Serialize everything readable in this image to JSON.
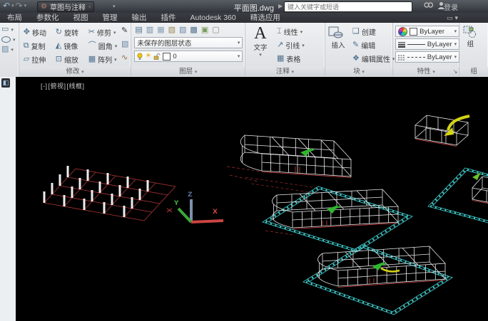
{
  "titlebar": {
    "workspace": "草图与注释",
    "doc_title": "平面图.dwg",
    "search_placeholder": "键入关键字或短语",
    "signin": "登录"
  },
  "tabs": {
    "layout": "布局",
    "parametric": "参数化",
    "view": "视图",
    "manage": "管理",
    "output": "输出",
    "plugins": "插件",
    "a360": "Autodesk 360",
    "featured": "精选应用"
  },
  "ribbon": {
    "modify": {
      "label": "修改",
      "move": "移动",
      "rotate": "旋转",
      "trim": "修剪",
      "copy": "复制",
      "mirror": "镜像",
      "fillet": "圆角",
      "stretch": "拉伸",
      "scale": "缩放",
      "array": "阵列"
    },
    "layers": {
      "label": "图层",
      "state": "未保存的图层状态",
      "current": "0"
    },
    "annotation": {
      "label": "注释",
      "text": "文字",
      "linear": "线性",
      "leader": "引线",
      "table": "表格"
    },
    "block": {
      "label": "块",
      "insert": "插入",
      "create": "创建",
      "edit": "编辑",
      "edit_attr": "编辑属性"
    },
    "properties": {
      "label": "特性",
      "color": "ByLayer",
      "lineweight": "ByLayer",
      "linetype": "ByLayer"
    },
    "group": {
      "label": "组",
      "tool": "组"
    }
  },
  "viewport": {
    "menu": "[-]",
    "view": "[俯视]",
    "style": "[线框]"
  },
  "colors": {
    "canvas": "#000000",
    "wire": "#ececec",
    "grid_red": "#b03636",
    "accent_red": "#d04040",
    "plate_cyan": "#3ec6c6",
    "arrow_green": "#2eb82e",
    "arrow_yellow": "#d4d414",
    "axis_x": "#cc4444",
    "axis_y": "#3aaa3a",
    "axis_z": "#7d8fae"
  }
}
